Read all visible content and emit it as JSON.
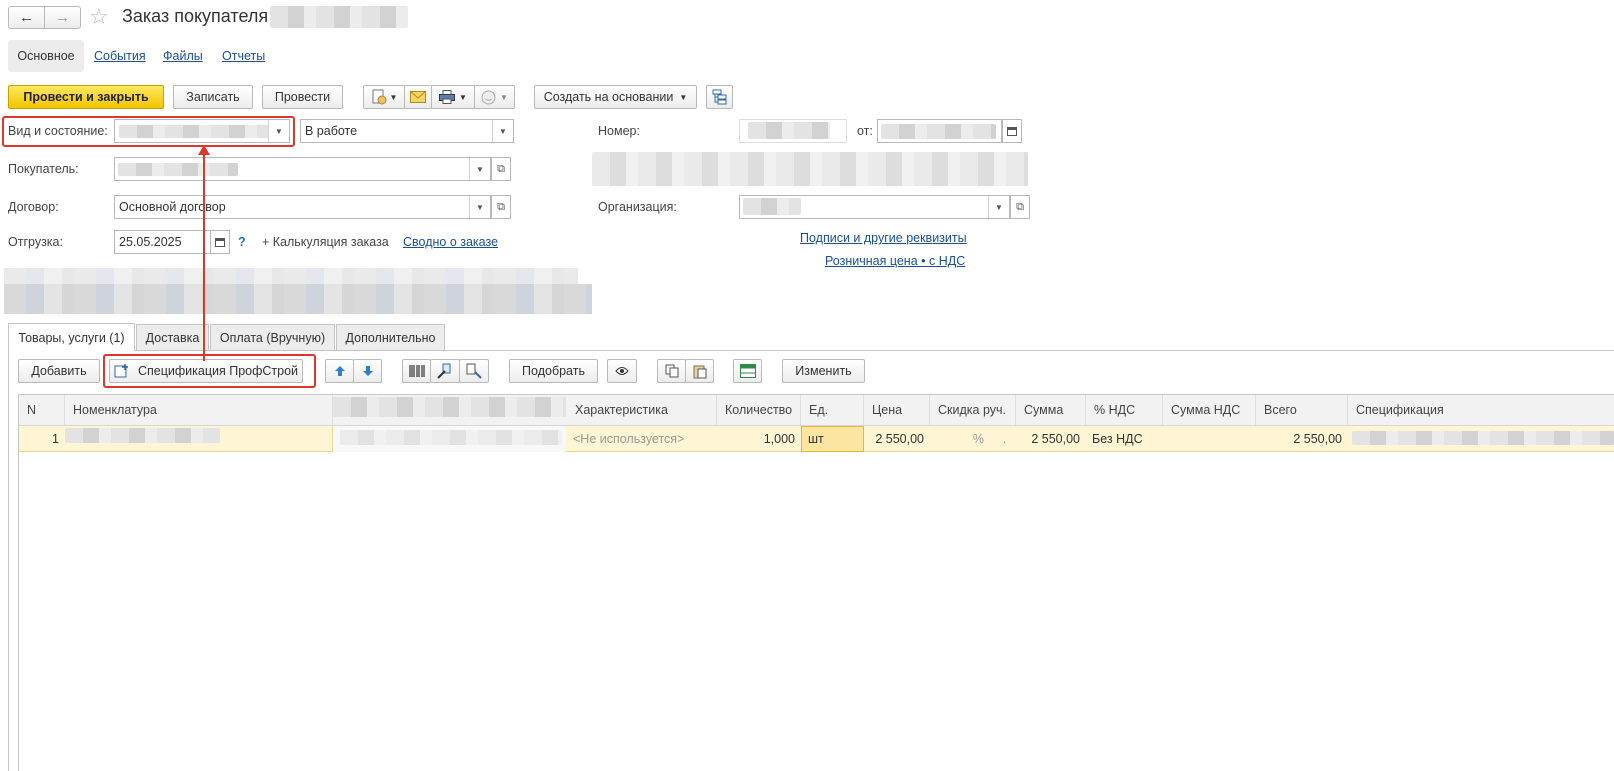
{
  "header": {
    "back_label": "←",
    "forward_label": "→",
    "star_label": "☆",
    "title": "Заказ покупателя"
  },
  "nav_tabs": [
    {
      "label": "Основное",
      "active": true
    },
    {
      "label": "События",
      "active": false
    },
    {
      "label": "Файлы",
      "active": false
    },
    {
      "label": "Отчеты",
      "active": false
    }
  ],
  "toolbar": {
    "post_close_label": "Провести и закрыть",
    "save_label": "Записать",
    "post_label": "Провести",
    "create_based_label": "Создать на основании"
  },
  "form": {
    "type_state_label": "Вид и состояние:",
    "state_value": "В работе",
    "buyer_label": "Покупатель:",
    "contract_label": "Договор:",
    "contract_value": "Основной договор",
    "shipment_label": "Отгрузка:",
    "shipment_date": "25.05.2025",
    "help_label": "?",
    "calc_label": "+ Калькуляция заказа",
    "summary_link": "Сводно о заказе",
    "number_label": "Номер:",
    "from_label": "от:",
    "org_label": "Организация:",
    "signatures_link": "Подписи и другие реквизиты",
    "retail_link": "Розничная цена • с НДС"
  },
  "section_tabs": [
    {
      "label": "Товары, услуги (1)",
      "active": true
    },
    {
      "label": "Доставка",
      "active": false
    },
    {
      "label": "Оплата (Вручную)",
      "active": false
    },
    {
      "label": "Дополнительно",
      "active": false
    }
  ],
  "table_toolbar": {
    "add_label": "Добавить",
    "spec_label": "Спецификация ПрофСтрой",
    "pick_label": "Подобрать",
    "change_label": "Изменить"
  },
  "table": {
    "columns": [
      "N",
      "Номенклатура",
      "Характеристика",
      "Количество",
      "Ед.",
      "Цена",
      "Скидка руч.",
      "Сумма",
      "% НДС",
      "Сумма НДС",
      "Всего",
      "Спецификация"
    ],
    "rows": [
      {
        "n": "1",
        "characteristic": "<Не используется>",
        "qty": "1,000",
        "unit": "шт",
        "price": "2 550,00",
        "discount": "%",
        "discount_dot": ".",
        "sum": "2 550,00",
        "vat_rate": "Без НДС",
        "vat_sum": "",
        "total": "2 550,00"
      }
    ]
  },
  "colors": {
    "accent_yellow": "#f4c400",
    "link_blue": "#1a4f9c",
    "annotation_red": "#e0352b",
    "row_highlight": "#fdf5d3"
  }
}
